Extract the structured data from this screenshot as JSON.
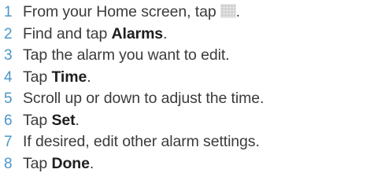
{
  "steps": [
    {
      "number": "1",
      "text_before": "From your Home screen, tap",
      "icon": "app-grid-icon",
      "text_after": "."
    },
    {
      "number": "2",
      "text_before": "Find and tap ",
      "bold": "Alarms",
      "text_after": "."
    },
    {
      "number": "3",
      "text_before": "Tap the alarm you want to edit.",
      "bold": "",
      "text_after": ""
    },
    {
      "number": "4",
      "text_before": "Tap ",
      "bold": "Time",
      "text_after": "."
    },
    {
      "number": "5",
      "text_before": "Scroll up or down to adjust the time.",
      "bold": "",
      "text_after": ""
    },
    {
      "number": "6",
      "text_before": "Tap ",
      "bold": "Set",
      "text_after": "."
    },
    {
      "number": "7",
      "text_before": "If desired, edit other alarm settings.",
      "bold": "",
      "text_after": ""
    },
    {
      "number": "8",
      "text_before": "Tap ",
      "bold": "Done",
      "text_after": "."
    }
  ],
  "colors": {
    "step_number": "#4a97c8",
    "body_text": "#3b3b3b",
    "icon_fill": "#d6d6d6"
  }
}
